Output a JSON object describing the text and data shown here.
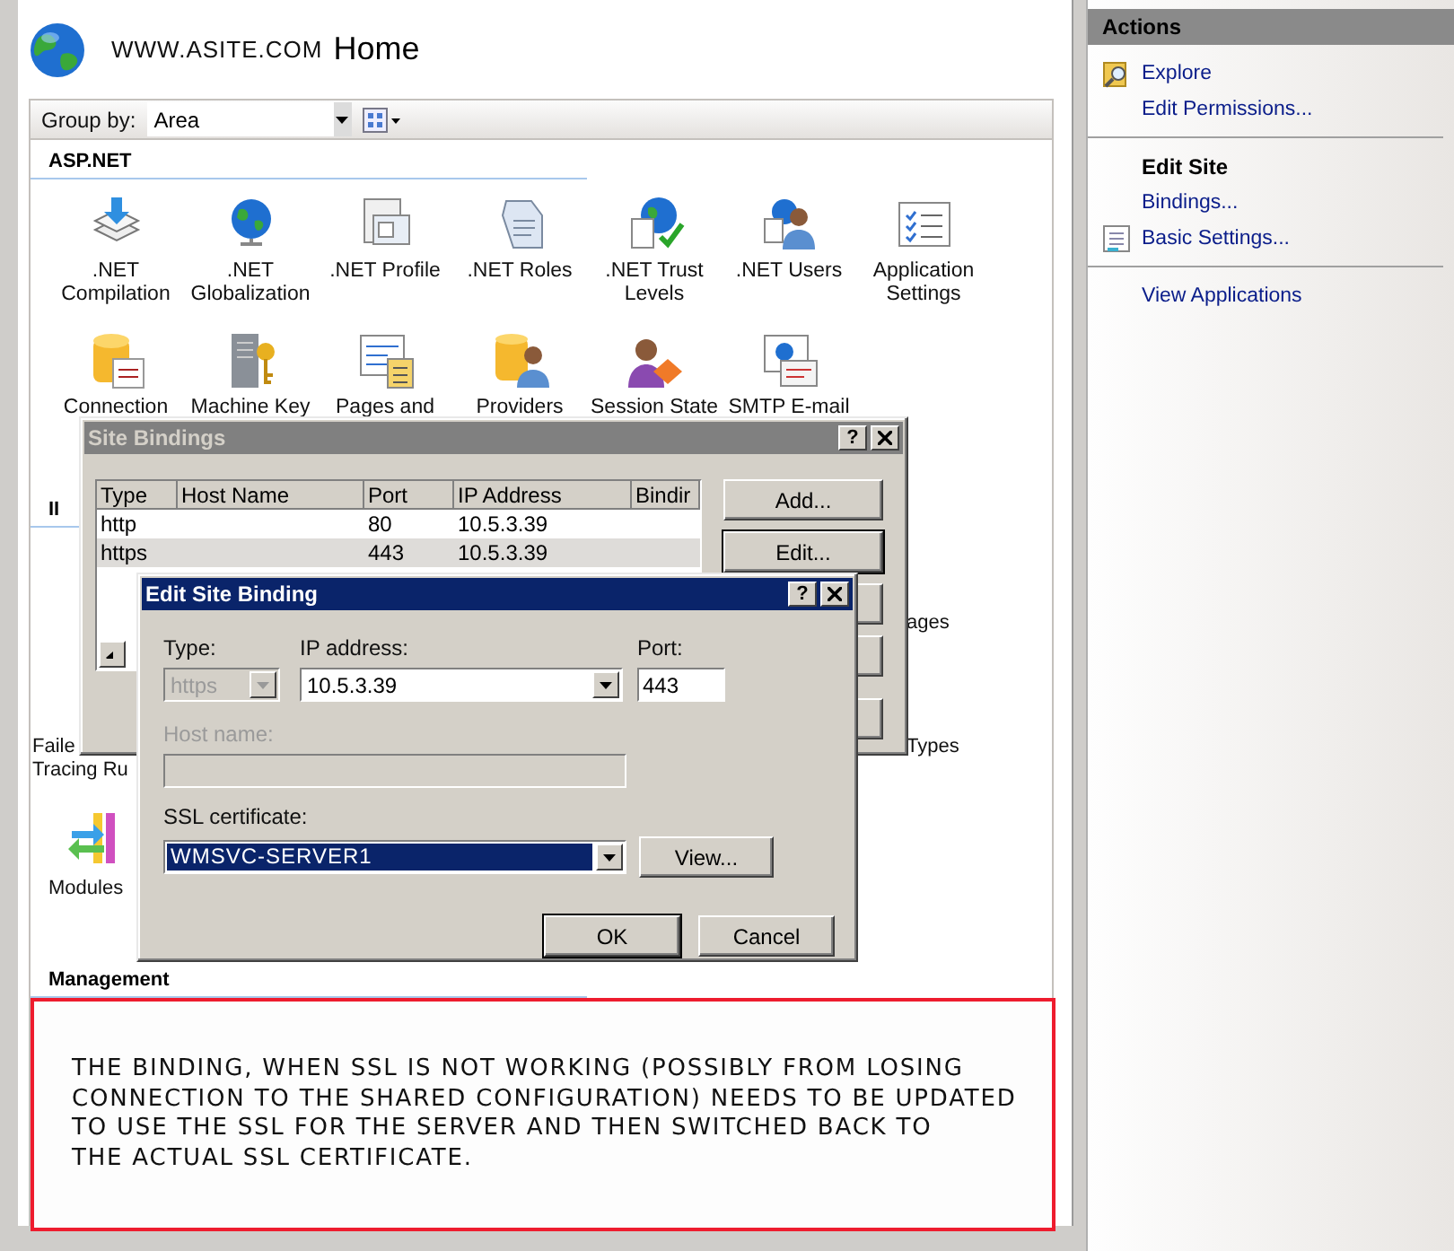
{
  "header": {
    "site": "WWW.ASITE.COM",
    "title": "Home"
  },
  "toolbar": {
    "label": "Group by:",
    "value": "Area"
  },
  "sections": [
    {
      "title": "ASP.NET",
      "features": [
        {
          "label": ".NET Compilation"
        },
        {
          "label": ".NET Globalization"
        },
        {
          "label": ".NET Profile"
        },
        {
          "label": ".NET Roles"
        },
        {
          "label": ".NET Trust Levels"
        },
        {
          "label": ".NET Users"
        },
        {
          "label": "Application Settings"
        },
        {
          "label": "Connection"
        },
        {
          "label": "Machine Key"
        },
        {
          "label": "Pages and"
        },
        {
          "label": "Providers"
        },
        {
          "label": "Session State"
        },
        {
          "label": "SMTP E-mail"
        }
      ]
    },
    {
      "title": "II",
      "features": [
        {
          "label": "ages"
        },
        {
          "label": "Faile\nTracing Ru"
        },
        {
          "label": "Types"
        },
        {
          "label": "Modules"
        }
      ]
    },
    {
      "title": "Management"
    }
  ],
  "site_bindings": {
    "title": "Site Bindings",
    "help_button": "?",
    "columns": [
      "Type",
      "Host Name",
      "Port",
      "IP Address",
      "Bindir"
    ],
    "rows": [
      {
        "type": "http",
        "port": "80",
        "ip_address": "10.5.3.39",
        "selected": false
      },
      {
        "type": "https",
        "port": "443",
        "ip_address": "10.5.3.39",
        "selected": true
      }
    ],
    "buttons": [
      {
        "label": "Add...",
        "default": false
      },
      {
        "label": "Edit...",
        "default": true
      }
    ]
  },
  "edit_binding": {
    "title": "Edit Site Binding",
    "help_button": "?",
    "type": {
      "label": "Type:",
      "value": "https",
      "disabled": true
    },
    "ip_address": {
      "label": "IP address:",
      "value": "10.5.3.39"
    },
    "port": {
      "label": "Port:",
      "value": "443"
    },
    "host_name": {
      "label": "Host name:",
      "disabled": true
    },
    "ssl_certificate": {
      "label": "SSL certificate:",
      "value": "WMSVC-SERVER1",
      "selected": true
    },
    "view_button": "View...",
    "buttons": [
      {
        "label": "OK",
        "default": true
      },
      {
        "label": "Cancel",
        "default": false
      }
    ]
  },
  "actions": {
    "title": "Actions",
    "groups": [
      {
        "items": [
          {
            "label": "Explore",
            "kind": "icon_link"
          },
          {
            "label": "Edit Permissions...",
            "kind": "link"
          }
        ]
      },
      {
        "title": "Edit Site",
        "items": [
          {
            "label": "Bindings...",
            "kind": "link"
          },
          {
            "label": "Basic Settings...",
            "kind": "icon_link"
          }
        ]
      },
      {
        "items": [
          {
            "label": "View Applications",
            "kind": "link"
          }
        ]
      }
    ]
  },
  "note": {
    "text": "THE BINDING, WHEN SSL IS NOT WORKING (POSSIBLY FROM LOSING\nCONNECTION TO THE SHARED CONFIGURATION) NEEDS TO BE UPDATED\nTO USE THE SSL FOR THE SERVER AND THEN SWITCHED BACK TO\nTHE ACTUAL SSL CERTIFICATE."
  }
}
